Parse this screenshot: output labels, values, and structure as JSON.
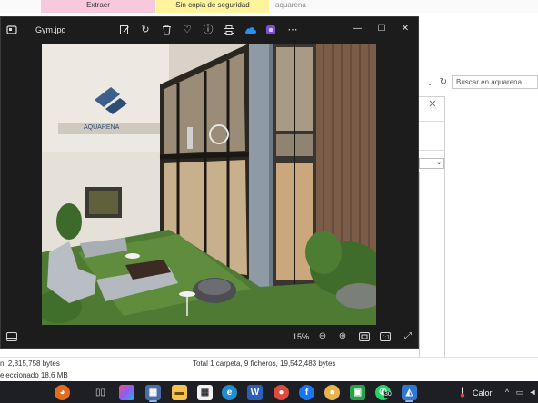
{
  "explorer": {
    "ribbon": {
      "extract_label": "Extraer",
      "backup_label": "Sin copia de seguridad",
      "path_text": "aquarena"
    },
    "search_placeholder": "Buscar en aquarena",
    "status_left": "n, 2,815,758 bytes",
    "status_right": "Total 1 carpeta, 9 ficheros, 19,542,483 bytes",
    "selection_text": "eleccionado  18.6 MB"
  },
  "photos": {
    "title": "Gym.jpg",
    "zoom": "15%",
    "toolbar_icons": [
      "edit-icon",
      "rotate-icon",
      "delete-icon",
      "favorite-icon",
      "info-icon",
      "print-icon",
      "onedrive-icon",
      "clipchamp-icon",
      "more-icon"
    ],
    "photo_sign": "AQUARENA"
  },
  "taskbar": {
    "weather_label": "Calor",
    "whatsapp_badge": "30",
    "icons": [
      "pumpkin-icon",
      "task-view-icon",
      "color-app-icon",
      "file-explorer-icon",
      "folder-icon",
      "calendar-icon",
      "edge-icon",
      "word-icon",
      "chrome-icon",
      "facebook-icon",
      "chrome-profile-icon",
      "green-app-icon",
      "whatsapp-icon",
      "photos-icon"
    ]
  },
  "colors": {
    "extract_bg": "#f8c8dc",
    "backup_bg": "#fff49c",
    "photos_bg": "#1c1c1c",
    "taskbar_bg": "#1e1f25",
    "accent": "#8ab4f8"
  }
}
